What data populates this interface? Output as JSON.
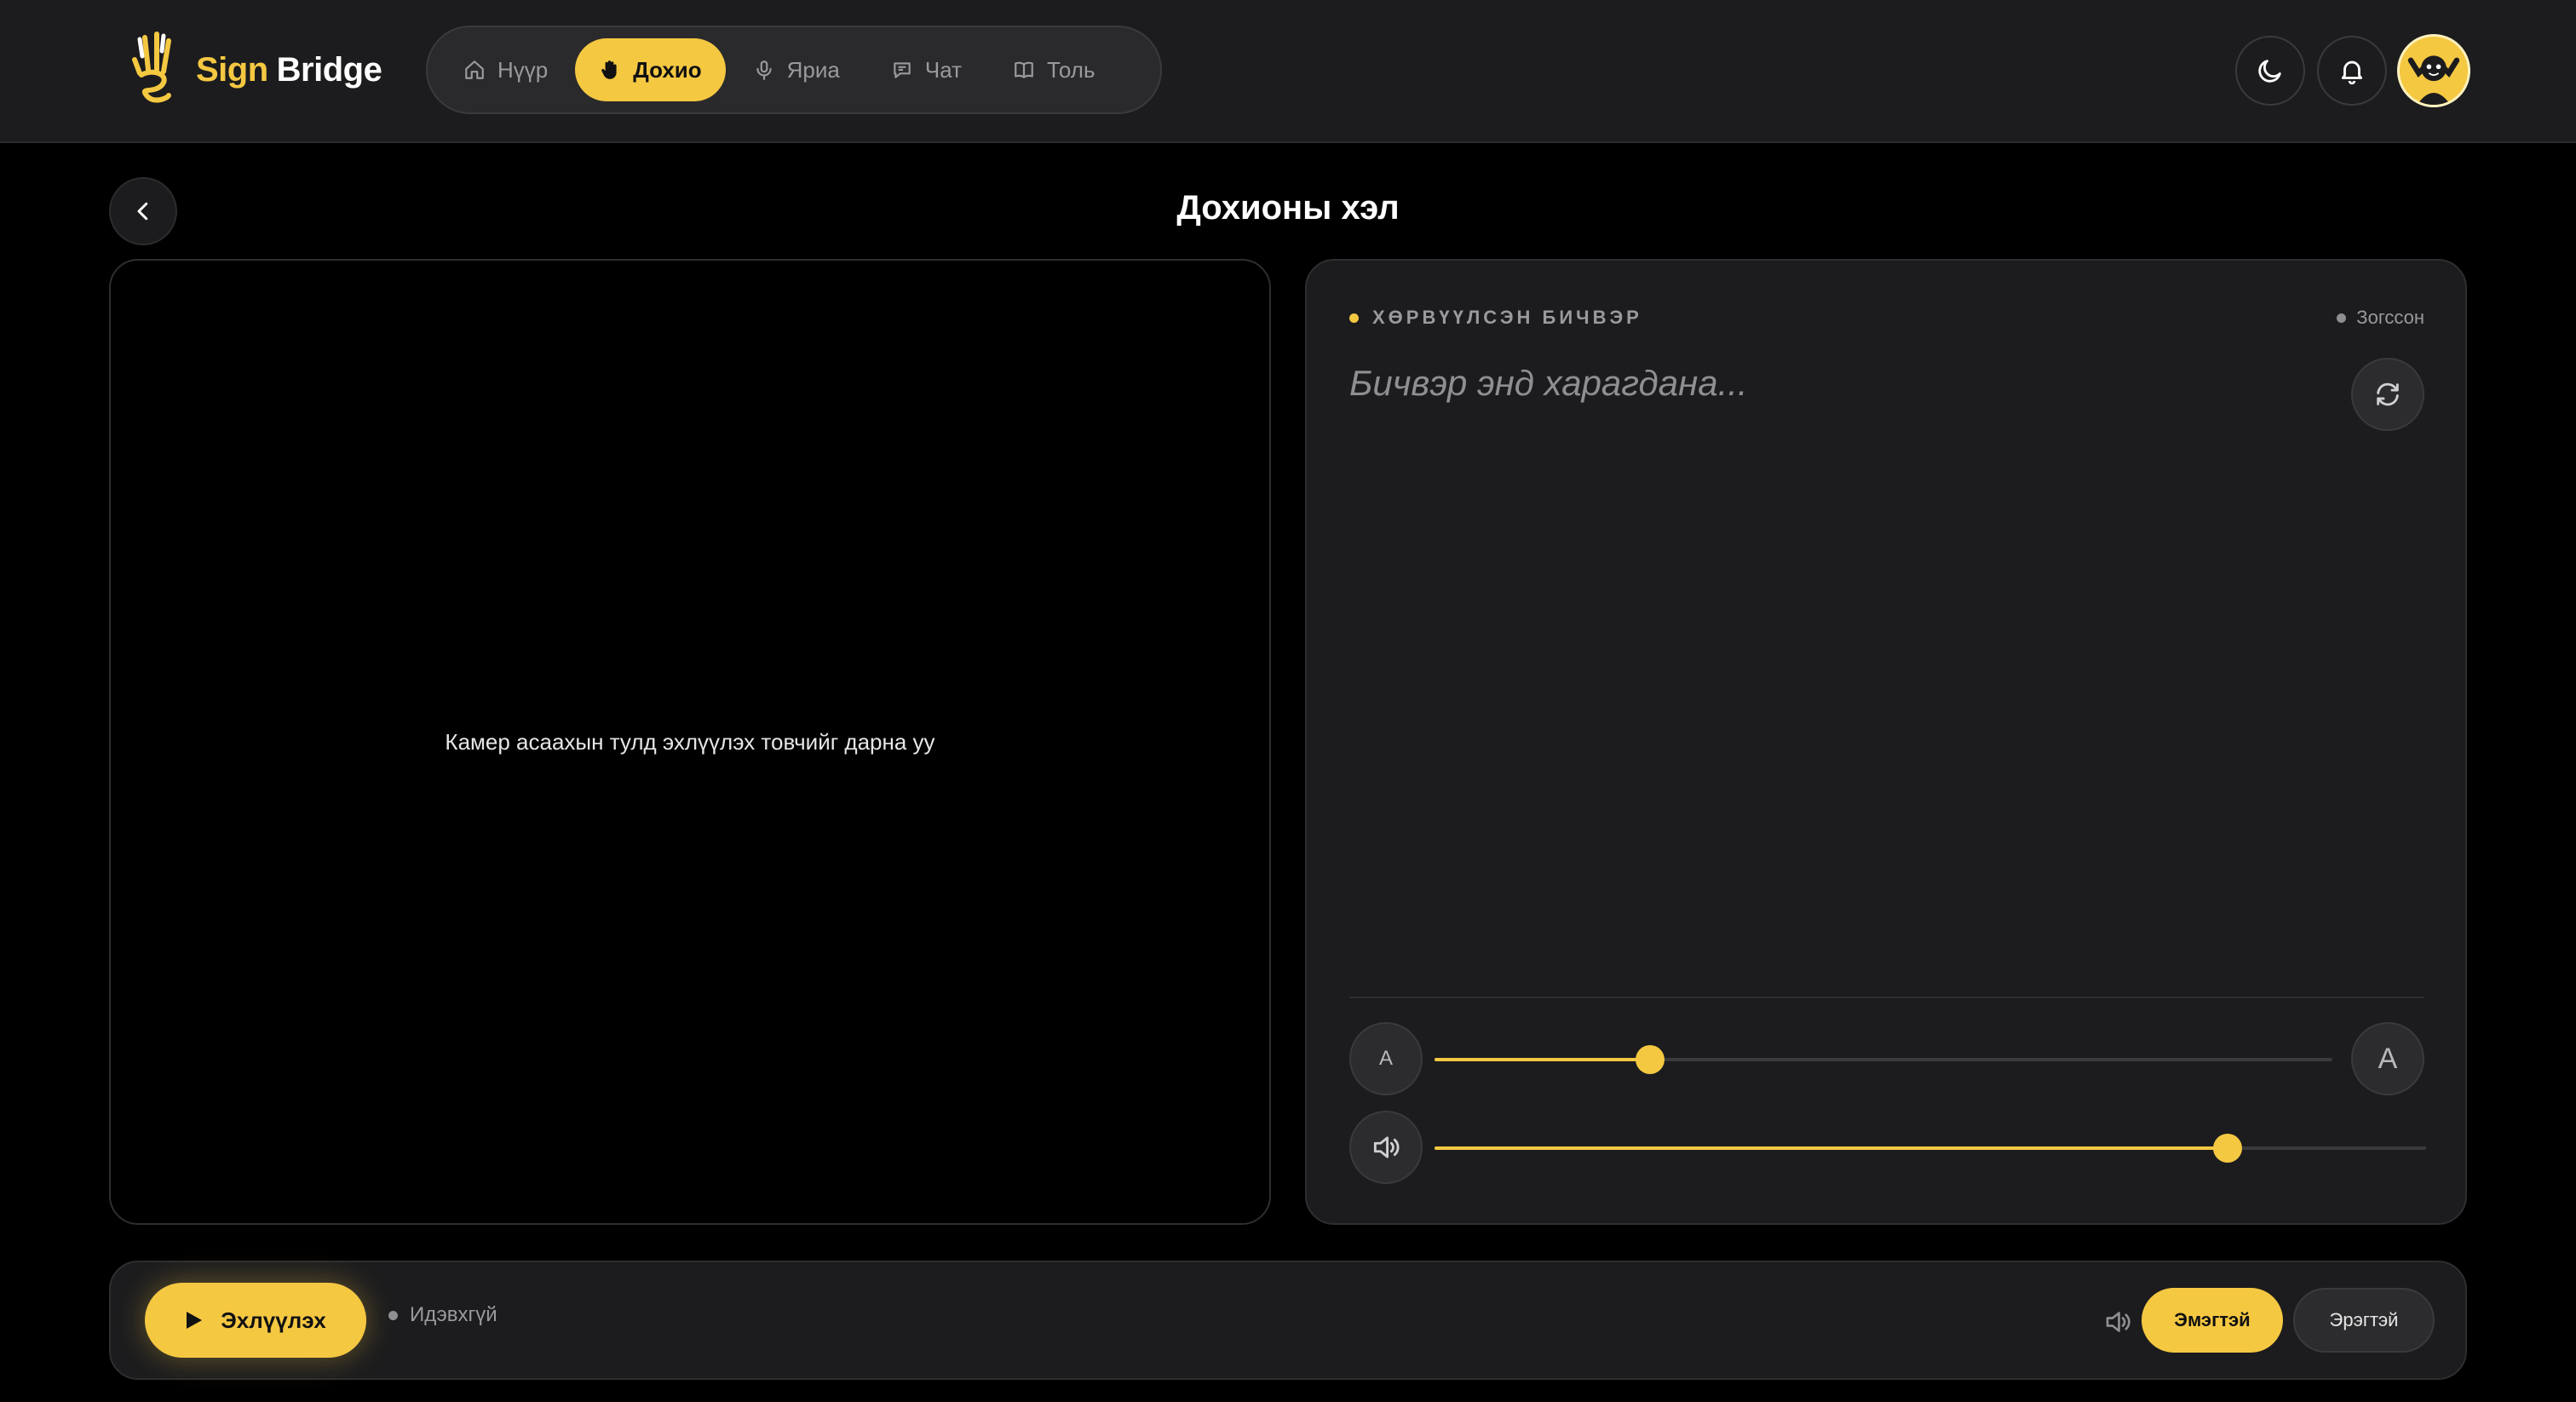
{
  "brand": {
    "name_part1": "Sign",
    "name_part2": "Bridge"
  },
  "nav": {
    "items": [
      {
        "label": "Нүүр",
        "icon": "home-icon",
        "active": false
      },
      {
        "label": "Дохио",
        "icon": "hand-icon",
        "active": true
      },
      {
        "label": "Яриа",
        "icon": "microphone-icon",
        "active": false
      },
      {
        "label": "Чат",
        "icon": "chat-icon",
        "active": false
      },
      {
        "label": "Толь",
        "icon": "book-icon",
        "active": false
      }
    ]
  },
  "header_actions": {
    "theme_icon": "moon-icon",
    "notifications_icon": "bell-icon"
  },
  "page": {
    "title": "Дохионы хэл"
  },
  "camera": {
    "hint": "Камер асаахын тулд эхлүүлэх товчийг дарна уу"
  },
  "output": {
    "label": "ХӨРВҮҮЛСЭН БИЧВЭР",
    "status": "Зогссон",
    "placeholder": "Бичвэр энд харагдана...",
    "font_small_label": "A",
    "font_large_label": "A",
    "font_size_level": 0.24,
    "volume_level": 0.8
  },
  "controls": {
    "start_label": "Эхлүүлэх",
    "status": "Идэвхгүй",
    "voice_female": "Эмэгтэй",
    "voice_male": "Эрэгтэй",
    "selected_voice": "female"
  },
  "colors": {
    "accent": "#f5c842",
    "background": "#000000",
    "surface": "#1c1c1e",
    "muted_text": "#9a9a9e"
  }
}
